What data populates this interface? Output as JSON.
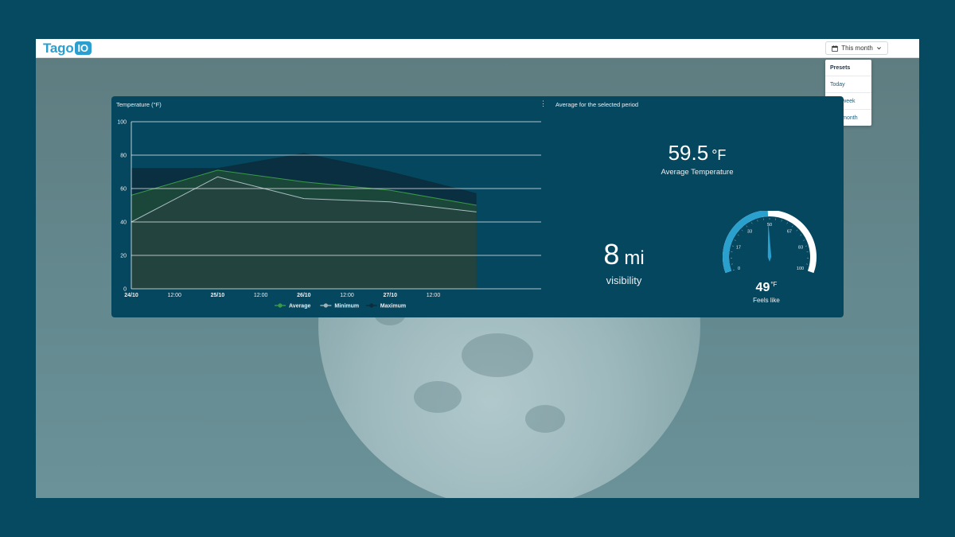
{
  "header": {
    "logo_word": "Tago",
    "logo_box": "IO",
    "period": "This month"
  },
  "presets_menu": {
    "heading": "Presets",
    "items": [
      "Today",
      "This week",
      "This month"
    ]
  },
  "temperature_widget": {
    "title": "Temperature (°F)"
  },
  "average_widget": {
    "title": "Average for the selected period",
    "avg_temp_value": "59.5",
    "avg_temp_unit": "°F",
    "avg_temp_label": "Average Temperature",
    "visibility_value": "8",
    "visibility_unit": "mi",
    "visibility_label": "visibility",
    "feels_like_value": "49",
    "feels_like_unit": "°F",
    "feels_like_label": "Feels like"
  },
  "gauge": {
    "min": 0,
    "max": 100,
    "value": 49,
    "ticks": [
      "0",
      "17",
      "33",
      "50",
      "67",
      "83",
      "100"
    ],
    "fill_color": "#2aa0cf",
    "track_color": "#ffffff"
  },
  "chart_data": {
    "type": "area",
    "title": "Temperature (°F)",
    "x_ticks": [
      "24/10",
      "12:00",
      "25/10",
      "12:00",
      "26/10",
      "12:00",
      "27/10",
      "12:00"
    ],
    "x_ticks_bold": [
      "24/10",
      "25/10",
      "26/10",
      "27/10"
    ],
    "y_ticks": [
      "0",
      "20",
      "40",
      "60",
      "80",
      "100"
    ],
    "ylim": [
      0,
      100
    ],
    "x_hours": [
      0,
      24,
      48,
      72,
      96
    ],
    "x_range_hours": [
      0,
      114
    ],
    "series": [
      {
        "name": "Maximum",
        "values": [
          72,
          72,
          81,
          70,
          57
        ],
        "color": "#0b2c3c"
      },
      {
        "name": "Average",
        "values": [
          56,
          71,
          64,
          59,
          50
        ],
        "color": "#2e7d3a"
      },
      {
        "name": "Minimum",
        "values": [
          40,
          67,
          54,
          52,
          46
        ],
        "color": "#9fb3b8"
      }
    ],
    "legend": [
      "Average",
      "Minimum",
      "Maximum"
    ],
    "legend_position": "bottom",
    "grid": true
  }
}
